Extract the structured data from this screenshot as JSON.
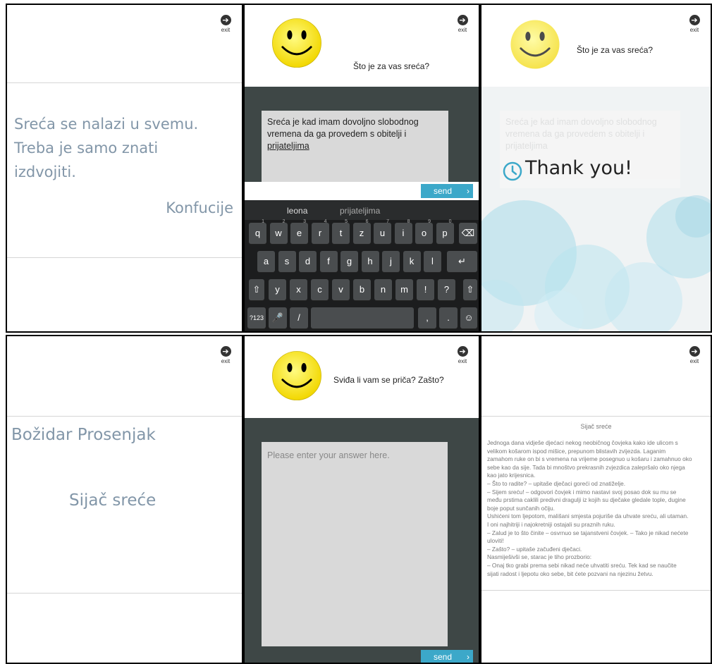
{
  "exit_label": "exit",
  "exit_glyph": "➔",
  "panel1": {
    "quote_lines": [
      "Sreća se nalazi u svemu.",
      "Treba je samo znati",
      "izdvojiti."
    ],
    "author": "Konfucije"
  },
  "panel2": {
    "question": "Što je za vas sreća?",
    "answer_lines": [
      "Sreća je kad imam dovoljno slobodnog",
      "vremena da ga provedem s obitelji i",
      "prijateljima"
    ],
    "send_label": "send",
    "suggestions": [
      "leona",
      "prijateljima"
    ],
    "keyboard": {
      "row1": [
        {
          "k": "q",
          "h": "1"
        },
        {
          "k": "w",
          "h": "2"
        },
        {
          "k": "e",
          "h": "3"
        },
        {
          "k": "r",
          "h": "4"
        },
        {
          "k": "t",
          "h": "5"
        },
        {
          "k": "z",
          "h": "6"
        },
        {
          "k": "u",
          "h": "7"
        },
        {
          "k": "i",
          "h": "8"
        },
        {
          "k": "o",
          "h": "9"
        },
        {
          "k": "p",
          "h": "0"
        }
      ],
      "row2": [
        "a",
        "s",
        "d",
        "f",
        "g",
        "h",
        "j",
        "k",
        "l"
      ],
      "row3": [
        "y",
        "x",
        "c",
        "v",
        "b",
        "n",
        "m",
        "!",
        "?"
      ],
      "numbers_key": "?123",
      "slash_key": "/",
      "comma_key": ",",
      "period_key": "."
    }
  },
  "panel3": {
    "question": "Što je za vas sreća?",
    "faded_lines": [
      "Sreća je kad imam dovoljno slobodnog",
      "vremena da ga provedem s obitelji i",
      "prijateljima"
    ],
    "thank_you": "Thank you!"
  },
  "panel4": {
    "author": "Božidar Prosenjak",
    "title": "Sijač sreće"
  },
  "panel5": {
    "question": "Sviđa li vam se priča? Zašto?",
    "placeholder": "Please enter your answer here.",
    "send_label": "send"
  },
  "panel6": {
    "title": "Sijač sreće",
    "lines": [
      "Jednoga dana vidješe djećaci nekog neobičnog čovjeka kako ide ulicom s",
      "velikom košarom ispod mišice, prepunom blistavih zvijezda. Laganim",
      "zamahom ruke on bi s vremena na vrijeme posegnuo u košaru i zamahnuo oko",
      "sebe kao da sije. Tada bi mnoštvo prekrasnih zvjezdica zalepršalo oko njega",
      "kao jato krijesnica.",
      "– Što to radite? – upitaše dječaci goreći od znatiželje.",
      "– Sijem sreću! – odgovori čovjek i mimo nastavi svoj posao dok su mu se",
      "među prstima caklili predivni dragulji iz kojih su dječake gledale tople, dugine",
      "boje poput sunčanih očiju.",
      "Ushićeni tom ljepotom, mališani smjesta pojuriše da uhvate sreću, ali utaman.",
      "I oni najhitriji i najokretniji ostajali su praznih ruku.",
      "– Zalud je to što činite – osvrnuo se tajanstveni čovjek. – Tako je nikad nećete",
      "uloviti!",
      "– Zašto? – upitaše začuđeni dječaci.",
      "Nasmiješivši se, starac je tiho prozborio:",
      "– Onaj tko grabi prema sebi nikad neće uhvatiti sreću. Tek kad se naučite",
      "sijati radost i ljepotu oko sebe, bit ćete pozvani na njezinu žetvu."
    ]
  }
}
